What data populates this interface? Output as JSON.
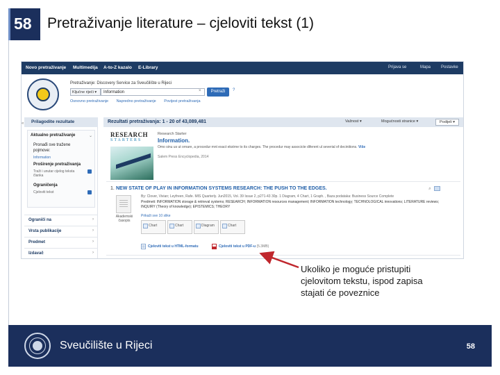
{
  "slide": {
    "number": "58",
    "title": "Pretraživanje literature – cjeloviti tekst (1)",
    "callout": "Ukoliko je moguće pristupiti cjelovitom tekstu, ispod zapisa stajati će poveznice",
    "footer_name": "Sveučilište u Rijeci",
    "footer_page": "58"
  },
  "screenshot": {
    "topnav": {
      "items": [
        "Novo pretraživanje",
        "Multimedija",
        "A-to-Z kazalo",
        "E-Library"
      ],
      "right": [
        "Prijava se",
        "Mapa",
        "Postavke"
      ]
    },
    "search": {
      "title": "Pretraživanje: Discovery Service za Sveučilište u Rijeci",
      "select_value": "Ključne riječi ▾",
      "input_value": "Information",
      "clear": "×",
      "button": "Pretraži",
      "help": "?",
      "links": [
        "Osnovno pretraživanje",
        "Napredno pretraživanje",
        "Povijest pretraživanja"
      ]
    },
    "sidebar": {
      "collapse": "«",
      "header": "Prilagodite rezultate",
      "current_search": "Aktualno pretraživanje",
      "find_all": "Pronađi sve tražene pojmove:",
      "term": "Information",
      "expanders": "Proširenje pretraživanja",
      "expander_item": "Traži i unutar cijelog teksta članka",
      "limiters": "Ograničenja",
      "limiter_item": "Cjeloviti tekst",
      "rows": [
        "Ograniči na",
        "Vrsta publikacije",
        "Predmet",
        "Izdavač"
      ],
      "chevron": "›"
    },
    "results": {
      "title": "Rezultati pretraživanja: 1 - 20 of 43,089,481",
      "relevance": "Važnost ▾",
      "page_options": "Mogućnosti stranice ▾",
      "share": "Podijeli ▾",
      "research_starter": {
        "logo_top": "RESEARCH",
        "logo_bottom": "STARTERS",
        "tag": "Research Starter",
        "heading": "Information.",
        "description": "Omo sinu us ut ornare, a procedur mnt exact ekstrne to its charges. The procedur may associcte diferent ul severial of decinitions.",
        "more": "Više",
        "source": "Salem Press Encyclopedia, 2014"
      },
      "item": {
        "number": "1.",
        "title": "NEW STATE OF PLAY IN INFORMATION SYSTEMS RESEARCH: THE PUSH TO THE EDGES.",
        "meta": "By: Clover, Vivian; Leyfreen, Rafe. MIS Quarterly. Jun2015, Vol. 39 Issue 2, p271-43 30p. 1 Diagram, 4 Chart, 1 Graph. , Baza podataka: Business Source Complete",
        "subjects": "Predmeti: INFORMATION storage & retrieval systems; RESEARCH; INFORMATION resources management; INFORMATION technology; TECHNOLOGICAL innovations; LITERATURE reviews; INQUIRY (Theory of knowledge); EPISTEMICS; THEORY",
        "doc_label": "Akademski časopis",
        "images_link": "Prikaži sve 10 slike",
        "thumbs": [
          "Chart",
          "Chart",
          "Diagram",
          "Chart"
        ],
        "html_fulltext": "Cjeloviti tekst u HTML-formatu",
        "pdf_fulltext": "Cjeloviti tekst u PDF-u",
        "pdf_size": "(5.3MB)"
      }
    }
  },
  "colors": {
    "nav": "#1d3b63",
    "footer": "#1b2f5c",
    "link": "#2e6bb7",
    "arrow": "#c0272d"
  }
}
